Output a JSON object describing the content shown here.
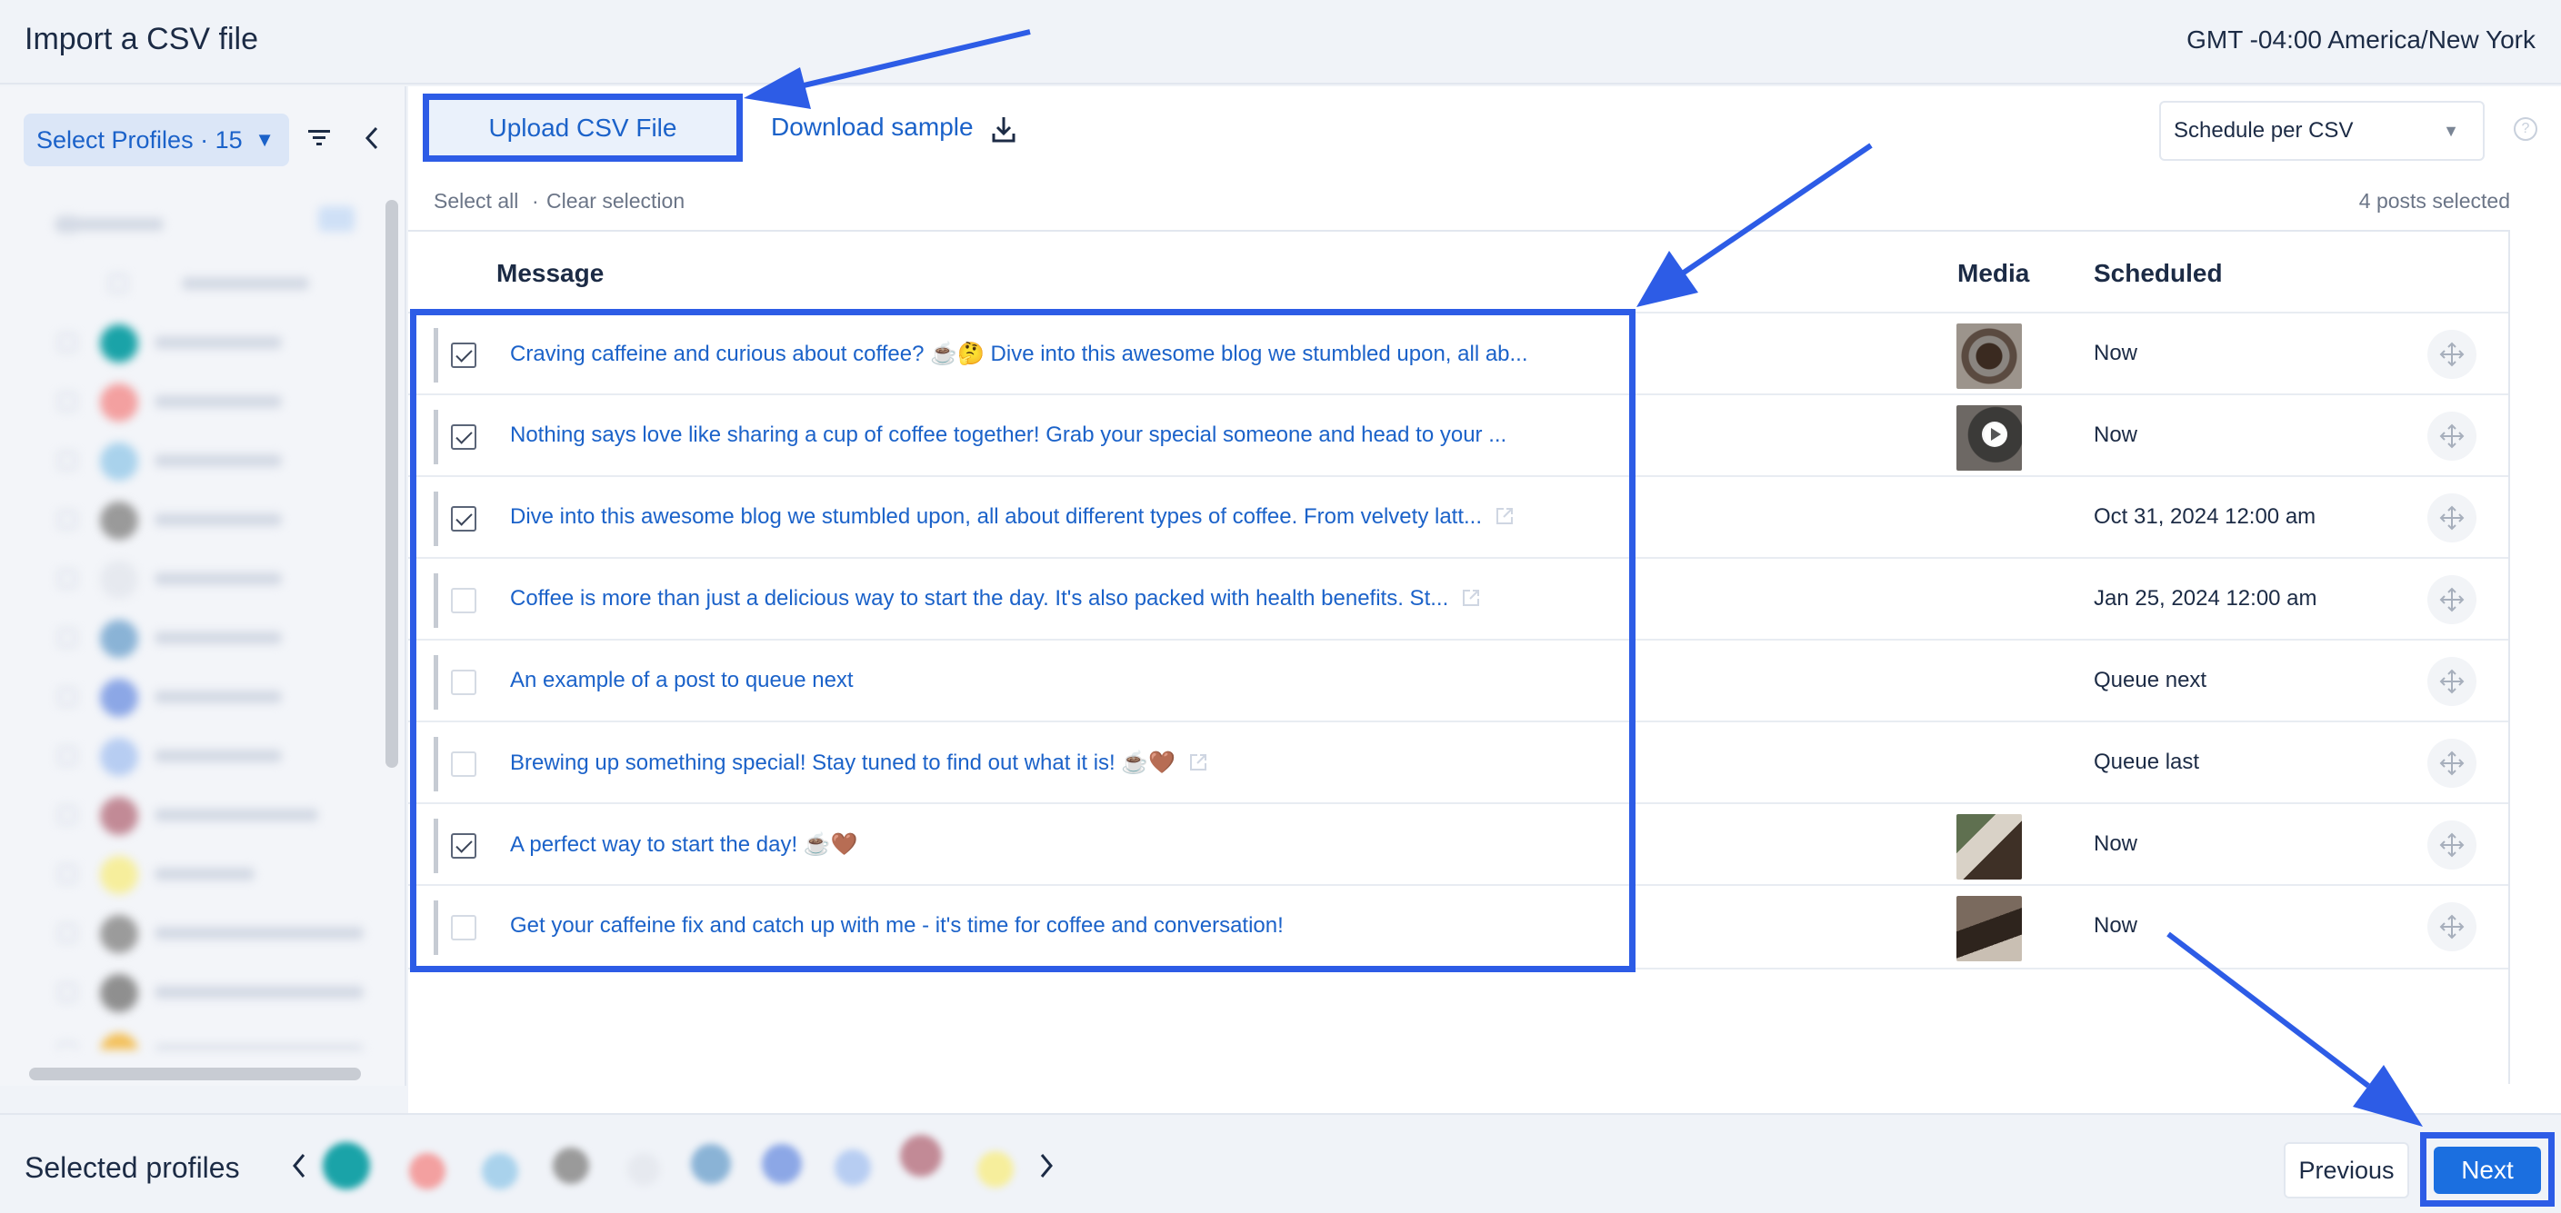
{
  "header": {
    "title": "Import a CSV file",
    "timezone": "GMT -04:00 America/New York"
  },
  "sidebar": {
    "profile_select_label": "Select Profiles · 15"
  },
  "toolbar": {
    "upload_label": "Upload CSV File",
    "download_label": "Download sample",
    "schedule_select_value": "Schedule per CSV"
  },
  "selection": {
    "select_all": "Select all",
    "separator": "·",
    "clear": "Clear selection",
    "count": "4 posts selected"
  },
  "table": {
    "columns": {
      "message": "Message",
      "media": "Media",
      "scheduled": "Scheduled"
    },
    "rows": [
      {
        "checked": true,
        "message": "Craving caffeine and curious about coffee? ☕🤔 Dive into this awesome blog we stumbled upon, all ab...",
        "link": false,
        "media": "coffee-top-view",
        "scheduled": "Now"
      },
      {
        "checked": true,
        "message": "Nothing says love like sharing a cup of coffee together! Grab your special someone and head to your ...",
        "link": false,
        "media": "video-thumbnail",
        "scheduled": "Now"
      },
      {
        "checked": true,
        "message": "Dive into this awesome blog we stumbled upon, all about different types of coffee. From velvety latt...",
        "link": true,
        "media": "",
        "scheduled": "Oct 31, 2024 12:00 am"
      },
      {
        "checked": false,
        "message": "Coffee is more than just a delicious way to start the day. It's also packed with health benefits. St...",
        "link": true,
        "media": "",
        "scheduled": "Jan 25, 2024 12:00 am"
      },
      {
        "checked": false,
        "message": "An example of a post to queue next",
        "link": false,
        "media": "",
        "scheduled": "Queue next"
      },
      {
        "checked": false,
        "message": "Brewing up something special! Stay tuned to find out what it is! ☕🤎",
        "link": true,
        "media": "",
        "scheduled": "Queue last"
      },
      {
        "checked": true,
        "message": "A perfect way to start the day! ☕🤎",
        "link": false,
        "media": "latte-art",
        "scheduled": "Now"
      },
      {
        "checked": false,
        "message": "Get your caffeine fix and catch up with me - it's time for coffee and conversation!",
        "link": false,
        "media": "coffee-beans",
        "scheduled": "Now"
      }
    ]
  },
  "footer": {
    "selected_profiles_label": "Selected profiles",
    "previous_label": "Previous",
    "next_label": "Next"
  },
  "colors": {
    "accent": "#1b62c9",
    "annotation": "#2d5ce6",
    "primary_button": "#1b6fe0"
  }
}
